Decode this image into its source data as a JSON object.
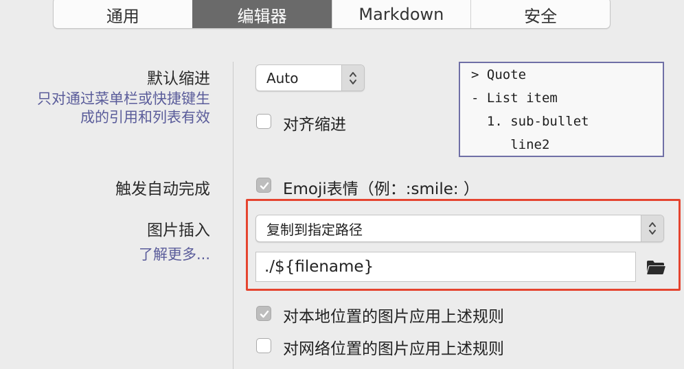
{
  "tabs": [
    {
      "label": "通用",
      "active": false
    },
    {
      "label": "编辑器",
      "active": true
    },
    {
      "label": "Markdown",
      "active": false
    },
    {
      "label": "安全",
      "active": false
    }
  ],
  "indent": {
    "label": "默认缩进",
    "note_line1": "只对通过菜单栏或快捷键生",
    "note_line2": "成的引用和列表有效",
    "select_value": "Auto",
    "align_label": "对齐缩进",
    "align_checked": false
  },
  "preview_lines": [
    "> Quote",
    "- List item",
    "  1. sub-bullet",
    "     line2"
  ],
  "autocomplete": {
    "label": "触发自动完成",
    "emoji_label": "Emoji表情（例：:smile: ）",
    "emoji_checked": true
  },
  "image_insert": {
    "label": "图片插入",
    "learn_more": "了解更多...",
    "select_value": "复制到指定路径",
    "path_value": "./${filename}",
    "local_rule_label": "对本地位置的图片应用上述规则",
    "local_rule_checked": true,
    "network_rule_label": "对网络位置的图片应用上述规则",
    "network_rule_checked": false
  },
  "icons": {
    "stepper": "up-down-chevron-icon",
    "folder": "folder-icon",
    "checkmark": "checkmark-icon"
  },
  "colors": {
    "accent_tab": "#6a6a6a",
    "note_text": "#5a5c9a",
    "highlight_border": "#e5442f",
    "preview_border": "#6f6fa6"
  }
}
